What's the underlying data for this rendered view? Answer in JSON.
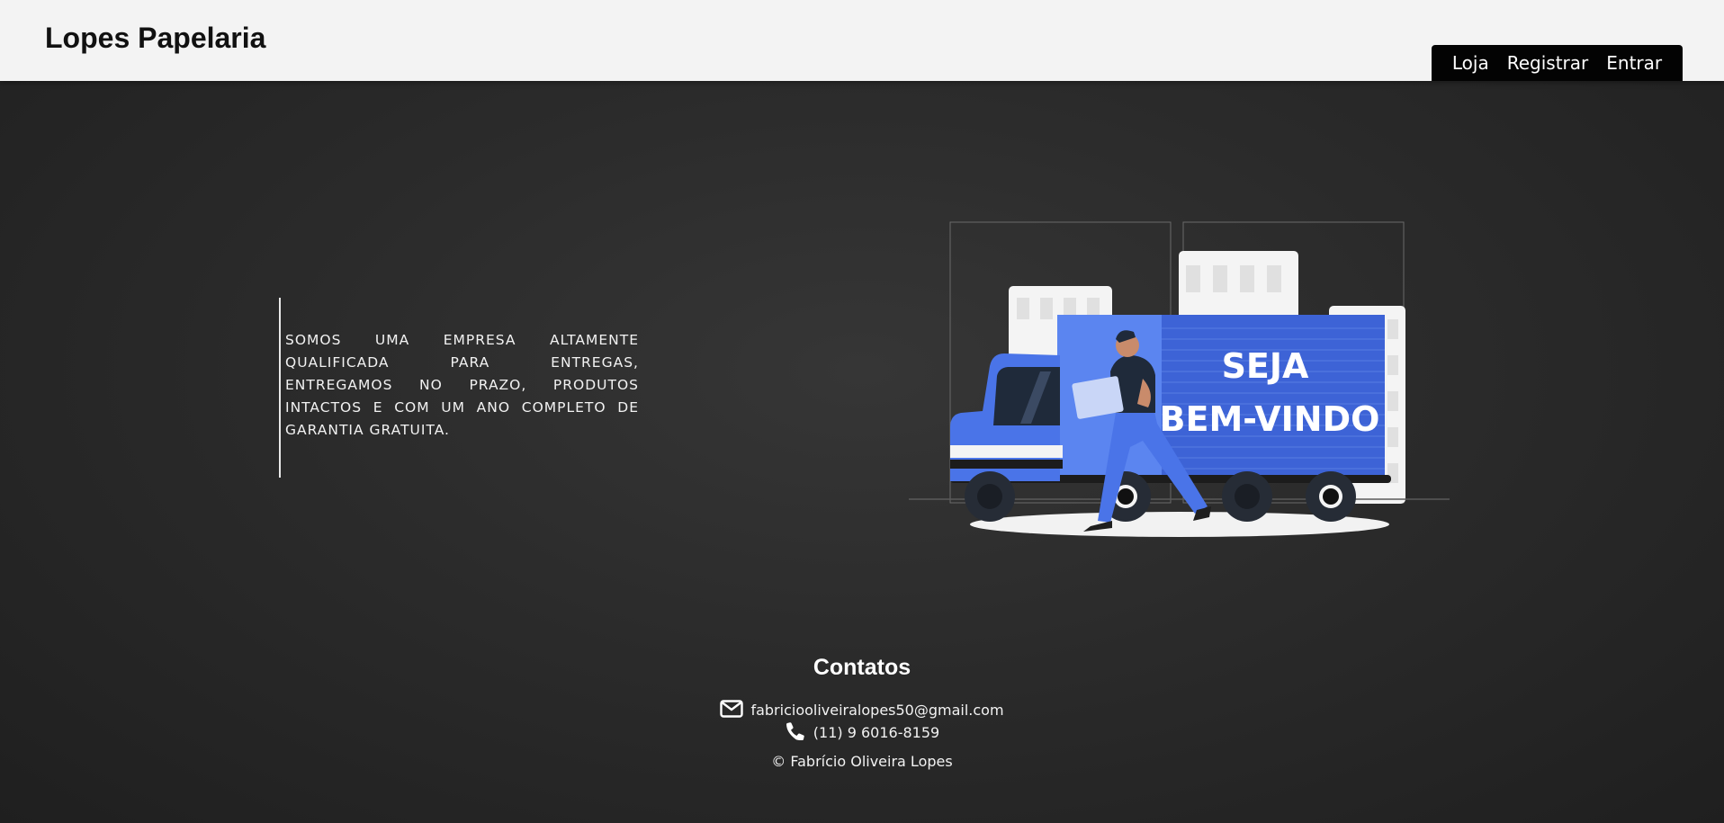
{
  "header": {
    "brand": "Lopes Papelaria",
    "nav": [
      "Loja",
      "Registrar",
      "Entrar"
    ]
  },
  "about": {
    "text": "SOMOS UMA EMPRESA ALTAMENTE QUALIFICADA PARA ENTREGAS, ENTREGAMOS NO PRAZO, PRODUTOS INTACTOS E COM UM ANO COMPLETO DE GARANTIA GRATUITA."
  },
  "hero": {
    "truck_text_line1": "SEJA",
    "truck_text_line2": "BEM-VINDO"
  },
  "footer": {
    "title": "Contatos",
    "email": "fabriciooliveiralopes50@gmail.com",
    "phone": "(11) 9 6016-8159",
    "copyright": "© Fabrício Oliveira Lopes"
  },
  "icons": {
    "email": "envelope-icon",
    "phone": "phone-icon"
  },
  "colors": {
    "header_bg": "#f3f3f3",
    "nav_bg": "#030303",
    "page_bg": "#2b2b2b",
    "truck_blue": "#4a74e8",
    "truck_dark_blue": "#3a5fcf"
  }
}
